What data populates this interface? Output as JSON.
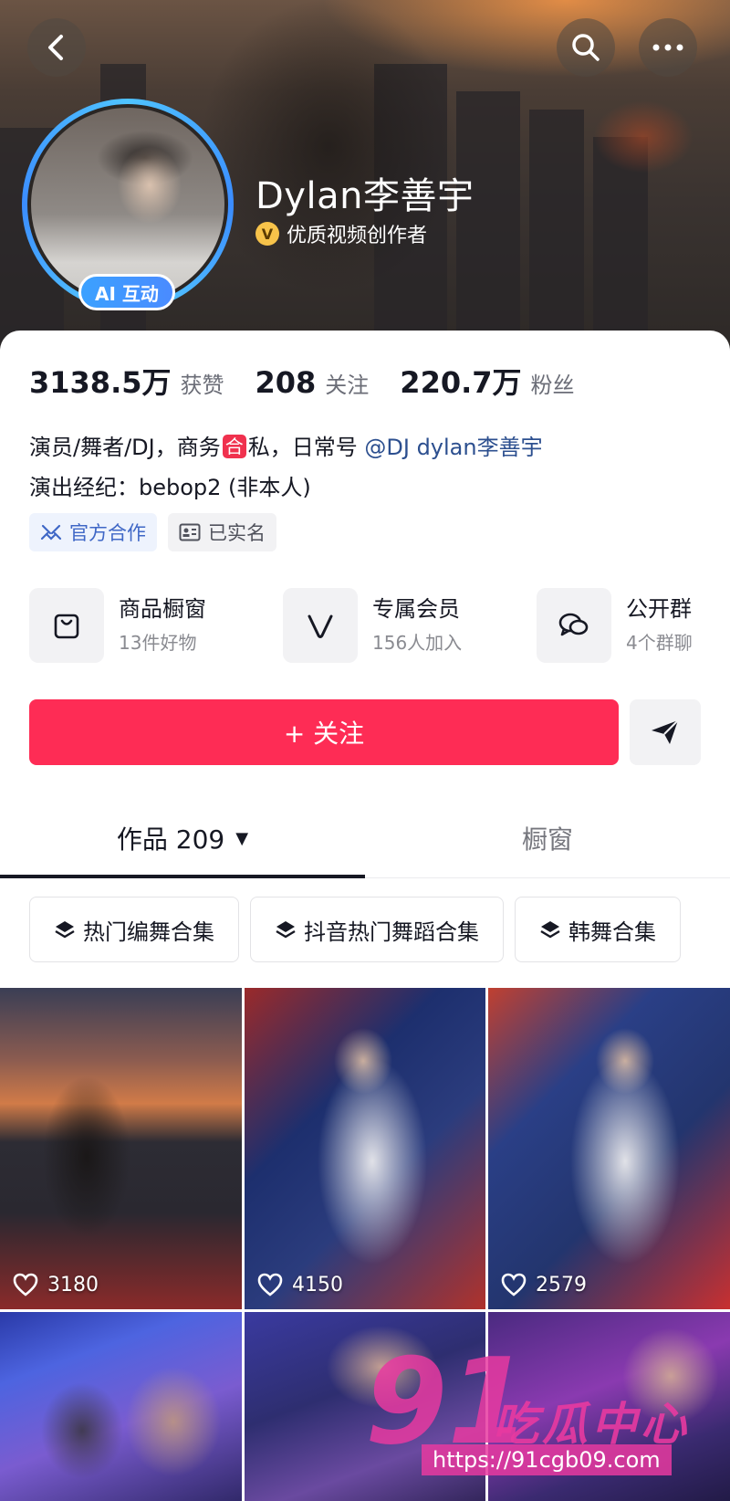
{
  "profile": {
    "username": "Dylan李善宇",
    "verified_label": "优质视频创作者",
    "ai_badge": "AI 互动"
  },
  "stats": [
    {
      "value": "3138.5万",
      "label": "获赞"
    },
    {
      "value": "208",
      "label": "关注"
    },
    {
      "value": "220.7万",
      "label": "粉丝"
    }
  ],
  "bio": {
    "line1_a": "演员/舞者/DJ，商务",
    "line1_he": "合",
    "line1_b": "私，日常号 ",
    "mention": "@DJ dylan李善宇",
    "line2": "演出经纪：bebop2 (非本人)"
  },
  "tags": [
    {
      "label": "官方合作",
      "icon": "handshake-icon"
    },
    {
      "label": "已实名",
      "icon": "id-card-icon"
    }
  ],
  "features": [
    {
      "title": "商品橱窗",
      "sub": "13件好物",
      "icon": "shopping-bag-icon"
    },
    {
      "title": "专属会员",
      "sub": "156人加入",
      "icon": "v-member-icon"
    },
    {
      "title": "公开群",
      "sub": "4个群聊",
      "icon": "chat-bubbles-icon"
    }
  ],
  "actions": {
    "follow_label": "+ 关注"
  },
  "tabs": [
    {
      "label": "作品 209"
    },
    {
      "label": "橱窗"
    }
  ],
  "collections": [
    {
      "label": "热门编舞合集"
    },
    {
      "label": "抖音热门舞蹈合集"
    },
    {
      "label": "韩舞合集"
    }
  ],
  "videos": [
    {
      "likes": "3180"
    },
    {
      "likes": "4150"
    },
    {
      "likes": "2579"
    },
    {
      "likes": ""
    },
    {
      "likes": ""
    },
    {
      "likes": ""
    }
  ],
  "watermark": {
    "logo": "91",
    "text": "吃瓜中心",
    "url": "https://91cgb09.com"
  },
  "colors": {
    "accent": "#fe2c55",
    "mention": "#2c4f8f",
    "ai_badge": "#3ba1ff",
    "verified": "#f7c34a"
  }
}
